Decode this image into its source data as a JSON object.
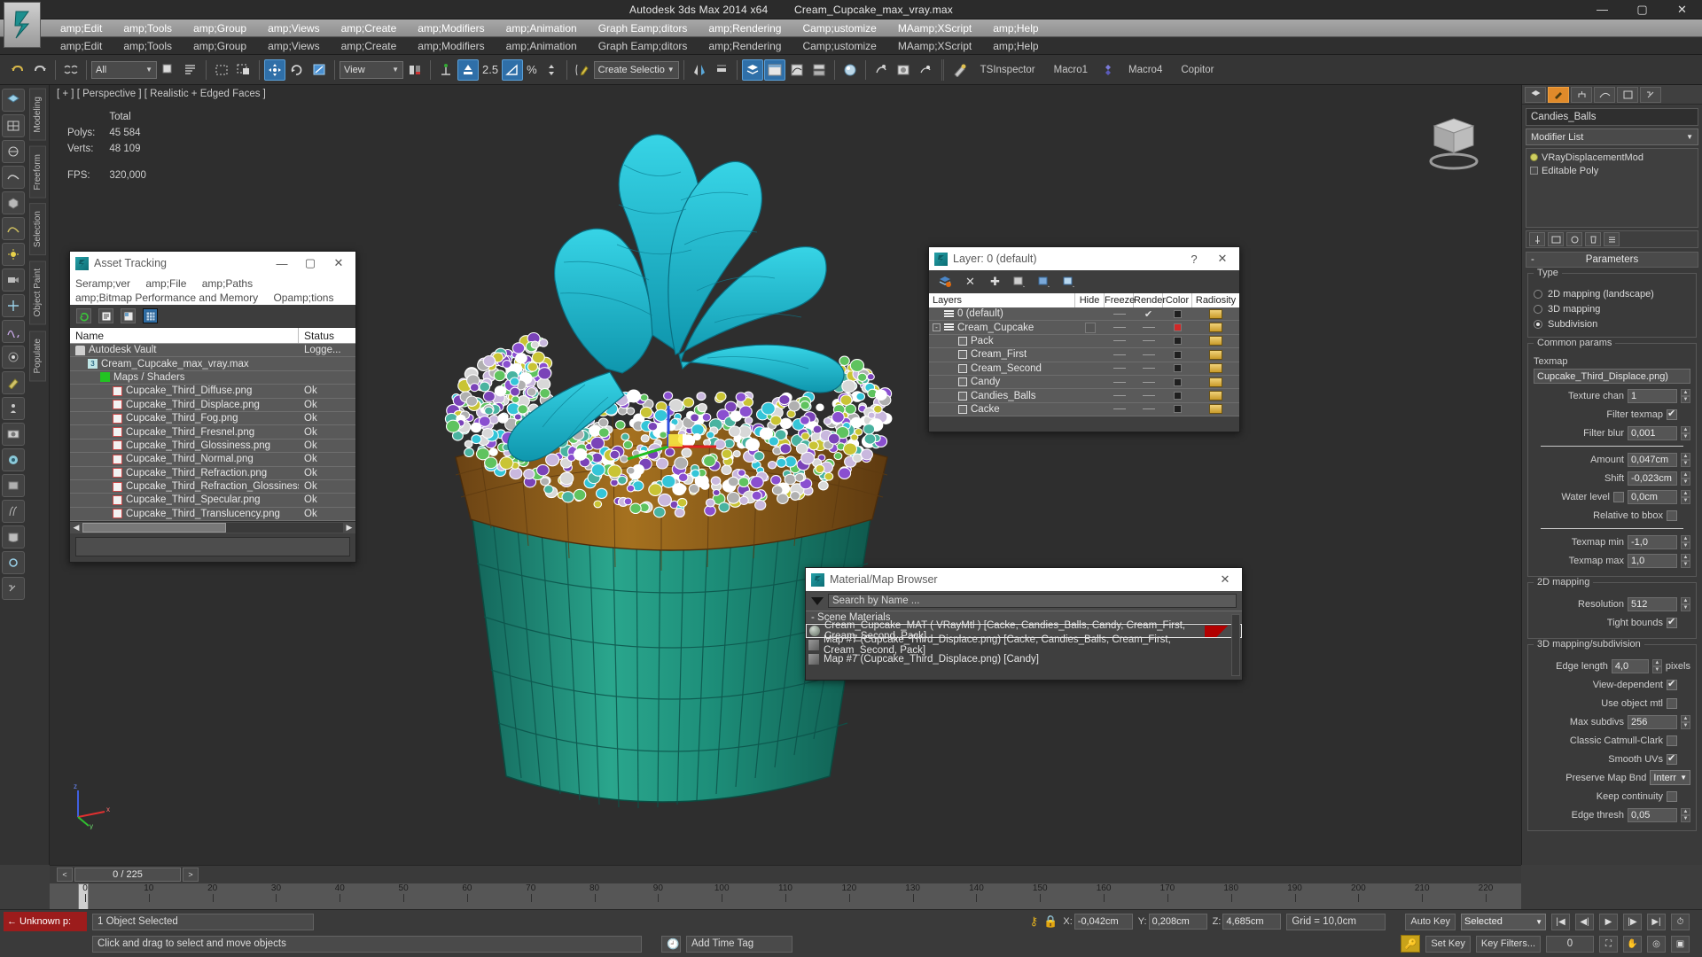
{
  "window": {
    "app_title": "Autodesk 3ds Max  2014 x64",
    "file_title": "Cream_Cupcake_max_vray.max",
    "minimize": "—",
    "maximize": "▢",
    "close": "✕"
  },
  "menus": {
    "main": [
      "amp;Edit",
      "amp;Tools",
      "amp;Group",
      "amp;Views",
      "amp;Create",
      "amp;Modifiers",
      "amp;Animation",
      "Graph Eamp;ditors",
      "amp;Rendering",
      "Camp;ustomize",
      "MAamp;XScript",
      "amp;Help"
    ],
    "secondary": [
      "amp;Edit",
      "amp;Tools",
      "amp;Group",
      "amp;Views",
      "amp;Create",
      "amp;Modifiers",
      "amp;Animation",
      "Graph Eamp;ditors",
      "amp;Rendering",
      "Camp;ustomize",
      "MAamp;XScript",
      "amp;Help"
    ]
  },
  "toolbar": {
    "selection_filter": "All",
    "reference_coord": "View",
    "snap_value": "2.5",
    "percent_symbol": "%",
    "named_selection_set": "Create Selection Se",
    "macro_buttons": [
      "TSInspector",
      "Macro1",
      "Macro4",
      "Copitor"
    ],
    "icons": [
      "undo-icon",
      "redo-icon",
      "link-icon",
      "unlink-icon",
      "bind-space-warp-icon",
      "select-object-icon",
      "select-by-name-icon",
      "rect-select-icon",
      "window-crossing-icon",
      "select-move-icon",
      "select-rotate-icon",
      "select-scale-icon",
      "mirror-icon",
      "align-icon",
      "snap-toggle-icon",
      "angle-snap-icon",
      "percent-snap-icon",
      "spinner-snap-icon",
      "edit-named-sets-icon",
      "mirror-panel-icon",
      "layer-manager-icon",
      "curve-editor-icon",
      "schematic-view-icon",
      "material-editor-icon",
      "render-setup-icon",
      "rendered-frame-icon",
      "render-production-icon",
      "quick-render-icon"
    ]
  },
  "viewport": {
    "label": "[ + ] [ Perspective ] [ Realistic + Edged Faces ]",
    "stats": {
      "total_header": "Total",
      "polys_label": "Polys:",
      "polys_value": "45 584",
      "verts_label": "Verts:",
      "verts_value": "48 109",
      "fps_label": "FPS:",
      "fps_value": "320,000"
    }
  },
  "left_toolbar": {
    "tabs": [
      "Modeling",
      "Freeform",
      "Selection",
      "Object Paint",
      "Populate"
    ],
    "icons": [
      "polygon-modeling-icon",
      "freeform-icon",
      "loop-tools-icon",
      "subdivision-icon",
      "deform-icon",
      "geometry-icon",
      "shapes-icon",
      "lights-icon",
      "cameras-icon",
      "helpers-icon",
      "space-warps-icon",
      "systems-icon",
      "paint-icon",
      "populate-icon",
      "snapshot-icon"
    ]
  },
  "asset_tracking": {
    "title": "Asset Tracking",
    "minimize": "—",
    "maximize": "▢",
    "close": "✕",
    "menus_row1": [
      "Seramp;ver",
      "amp;File",
      "amp;Paths"
    ],
    "menus_row2": [
      "amp;Bitmap Performance and Memory",
      "Opamp;tions"
    ],
    "toolbar_icons": [
      "refresh-icon",
      "list-view-icon",
      "details-view-icon",
      "grid-view-icon"
    ],
    "columns": [
      "Name",
      "Status"
    ],
    "rows": [
      {
        "name": "Autodesk Vault",
        "status": "Logge...",
        "indent": 1,
        "icon": "vault-icon"
      },
      {
        "name": "Cream_Cupcake_max_vray.max",
        "status": "",
        "indent": 2,
        "icon": "max-file-icon"
      },
      {
        "name": "Maps / Shaders",
        "status": "",
        "indent": 3,
        "icon": "maps-shaders-icon"
      },
      {
        "name": "Cupcake_Third_Diffuse.png",
        "status": "Ok",
        "indent": 4,
        "icon": "png-icon"
      },
      {
        "name": "Cupcake_Third_Displace.png",
        "status": "Ok",
        "indent": 4,
        "icon": "png-icon"
      },
      {
        "name": "Cupcake_Third_Fog.png",
        "status": "Ok",
        "indent": 4,
        "icon": "png-icon"
      },
      {
        "name": "Cupcake_Third_Fresnel.png",
        "status": "Ok",
        "indent": 4,
        "icon": "png-icon"
      },
      {
        "name": "Cupcake_Third_Glossiness.png",
        "status": "Ok",
        "indent": 4,
        "icon": "png-icon"
      },
      {
        "name": "Cupcake_Third_Normal.png",
        "status": "Ok",
        "indent": 4,
        "icon": "png-icon"
      },
      {
        "name": "Cupcake_Third_Refraction.png",
        "status": "Ok",
        "indent": 4,
        "icon": "png-icon"
      },
      {
        "name": "Cupcake_Third_Refraction_Glossiness.png",
        "status": "Ok",
        "indent": 4,
        "icon": "png-icon"
      },
      {
        "name": "Cupcake_Third_Specular.png",
        "status": "Ok",
        "indent": 4,
        "icon": "png-icon"
      },
      {
        "name": "Cupcake_Third_Translucency.png",
        "status": "Ok",
        "indent": 4,
        "icon": "png-icon"
      }
    ]
  },
  "layer_dialog": {
    "title": "Layer: 0 (default)",
    "help": "?",
    "close": "✕",
    "toolbar_icons": [
      "create-new-layer-icon",
      "delete-layer-icon",
      "add-selection-icon",
      "select-objects-icon",
      "highlight-icon",
      "layer-properties-icon"
    ],
    "columns": [
      "Layers",
      "Hide",
      "Freeze",
      "Render",
      "Color",
      "Radiosity"
    ],
    "rows": [
      {
        "name": "0 (default)",
        "indent": 1,
        "type": "layer",
        "hide": "",
        "freeze": "dash",
        "render": "check",
        "color": "dark",
        "radiosity": "on"
      },
      {
        "name": "Cream_Cupcake",
        "indent": 1,
        "type": "layer",
        "expander": "-",
        "hide": "box",
        "freeze": "dash",
        "render": "dash",
        "color": "red",
        "radiosity": "on"
      },
      {
        "name": "Pack",
        "indent": 2,
        "type": "object",
        "hide": "",
        "freeze": "dash",
        "render": "dash",
        "color": "dark",
        "radiosity": "on"
      },
      {
        "name": "Cream_First",
        "indent": 2,
        "type": "object",
        "hide": "",
        "freeze": "dash",
        "render": "dash",
        "color": "dark",
        "radiosity": "on"
      },
      {
        "name": "Cream_Second",
        "indent": 2,
        "type": "object",
        "hide": "",
        "freeze": "dash",
        "render": "dash",
        "color": "dark",
        "radiosity": "on"
      },
      {
        "name": "Candy",
        "indent": 2,
        "type": "object",
        "hide": "",
        "freeze": "dash",
        "render": "dash",
        "color": "dark",
        "radiosity": "on"
      },
      {
        "name": "Candies_Balls",
        "indent": 2,
        "type": "object",
        "hide": "",
        "freeze": "dash",
        "render": "dash",
        "color": "dark",
        "radiosity": "on"
      },
      {
        "name": "Cacke",
        "indent": 2,
        "type": "object",
        "hide": "",
        "freeze": "dash",
        "render": "dash",
        "color": "dark",
        "radiosity": "on"
      }
    ]
  },
  "material_browser": {
    "title": "Material/Map Browser",
    "close": "✕",
    "search_placeholder": "Search by Name ...",
    "group_label": "- Scene Materials",
    "rows": [
      {
        "text": "Cream_Cupcake_MAT  ( VRayMtl )  [Cacke, Candies_Balls, Candy, Cream_First, Cream_Second, Pack]",
        "selected": true,
        "icon": "material-sphere-icon"
      },
      {
        "text": "Map #7 (Cupcake_Third_Displace.png)  [Cacke, Candies_Balls, Cream_First, Cream_Second, Pack]",
        "selected": false,
        "icon": "map-icon"
      },
      {
        "text": "Map #7 (Cupcake_Third_Displace.png)  [Candy]",
        "selected": false,
        "icon": "map-icon"
      }
    ]
  },
  "command_panel": {
    "tabs": [
      "create-tab",
      "modify-tab",
      "hierarchy-tab",
      "motion-tab",
      "display-tab",
      "utilities-tab"
    ],
    "object_name": "Candies_Balls",
    "modifier_list_label": "Modifier List",
    "stack": [
      {
        "label": "VRayDisplacementMod",
        "type": "modifier"
      },
      {
        "label": "Editable Poly",
        "type": "base"
      }
    ],
    "parameters": {
      "rollout_title": "Parameters",
      "type_group": "Type",
      "type_options": [
        "2D mapping (landscape)",
        "3D mapping",
        "Subdivision"
      ],
      "type_selected": "Subdivision",
      "common_group": "Common params",
      "texmap_label": "Texmap",
      "texmap_value": "Cupcake_Third_Displace.png)",
      "texture_chan_label": "Texture chan",
      "texture_chan_value": "1",
      "filter_texmap_label": "Filter texmap",
      "filter_texmap_checked": true,
      "filter_blur_label": "Filter blur",
      "filter_blur_value": "0,001",
      "amount_label": "Amount",
      "amount_value": "0,047cm",
      "shift_label": "Shift",
      "shift_value": "-0,023cm",
      "water_level_label": "Water level",
      "water_level_checked": false,
      "water_level_value": "0,0cm",
      "relative_bbox_label": "Relative to bbox",
      "relative_bbox_checked": false,
      "texmap_min_label": "Texmap min",
      "texmap_min_value": "-1,0",
      "texmap_max_label": "Texmap max",
      "texmap_max_value": "1,0",
      "mapping2d_group": "2D mapping",
      "resolution_label": "Resolution",
      "resolution_value": "512",
      "tight_bounds_label": "Tight bounds",
      "tight_bounds_checked": true,
      "mapping3d_group": "3D mapping/subdivision",
      "edge_length_label": "Edge length",
      "edge_length_value": "4,0",
      "edge_length_unit": "pixels",
      "view_dependent_label": "View-dependent",
      "view_dependent_checked": true,
      "use_object_mtl_label": "Use object mtl",
      "use_object_mtl_checked": false,
      "max_subdivs_label": "Max subdivs",
      "max_subdivs_value": "256",
      "catmull_label": "Classic Catmull-Clark",
      "catmull_checked": false,
      "smooth_uvs_label": "Smooth UVs",
      "smooth_uvs_checked": true,
      "preserve_map_label": "Preserve Map Bnd",
      "preserve_map_value": "Interr",
      "keep_continuity_label": "Keep continuity",
      "keep_continuity_checked": false,
      "edge_thresh_label": "Edge thresh",
      "edge_thresh_value": "0,05"
    }
  },
  "timeline": {
    "current_frame": "0 / 225",
    "prev": "<",
    "next": ">",
    "ticks": [
      0,
      10,
      20,
      30,
      40,
      50,
      60,
      70,
      80,
      90,
      100,
      110,
      120,
      130,
      140,
      150,
      160,
      170,
      180,
      190,
      200,
      210,
      220
    ]
  },
  "status": {
    "unknown_label": "Unknown",
    "unknown_suffix": "p:",
    "selection_text": "1 Object Selected",
    "prompt_text": "Click and drag to select and move objects",
    "coords": [
      {
        "label": "X:",
        "value": "-0,042cm"
      },
      {
        "label": "Y:",
        "value": "0,208cm"
      },
      {
        "label": "Z:",
        "value": "4,685cm"
      }
    ],
    "grid_text": "Grid = 10,0cm",
    "add_time_tag": "Add Time Tag",
    "auto_key": "Auto Key",
    "set_key": "Set Key",
    "selected_dropdown": "Selected",
    "key_filters": "Key Filters...",
    "key_frame_value": "0"
  },
  "colors": {
    "accent_blue": "#2f6fa8",
    "accent_orange": "#e08a2a",
    "error_red": "#9c1c1c",
    "panel_bg": "#3a3a3a",
    "viewport_bg": "#2e2e2e",
    "cupcake_cream": "#2bc3d4",
    "cupcake_wrapper": "#1f8a77",
    "cupcake_cake": "#8a5a1e"
  }
}
